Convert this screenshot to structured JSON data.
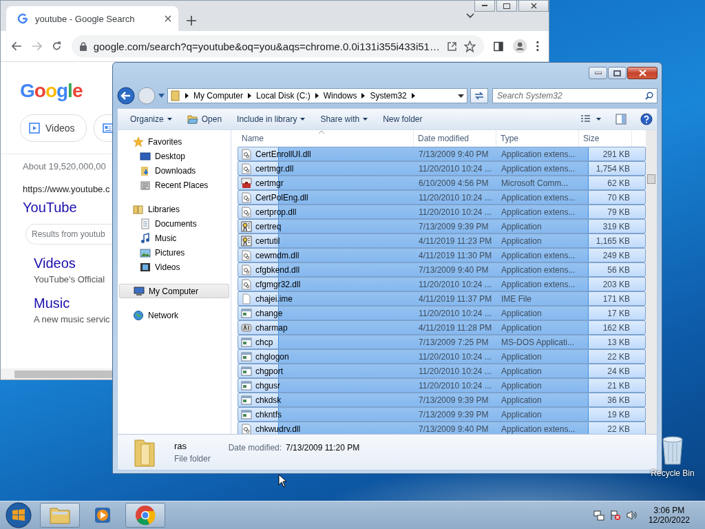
{
  "browser": {
    "tab": {
      "title": "youtube - Google Search",
      "selected": true
    },
    "address": "google.com/search?q=youtube&oq=you&aqs=chrome.0.0i131i355i433i51…",
    "page": {
      "logo": "Google",
      "chips": [
        {
          "label": "Videos",
          "kind": "videos"
        },
        {
          "kind": "news"
        }
      ],
      "stats": "About 19,520,000,00",
      "result_url": "https://www.youtube.c",
      "result_title": "YouTube",
      "site_search_placeholder": "Results from youtub",
      "sitelinks": [
        {
          "title": "Videos",
          "snippet": "YouTube's Official"
        },
        {
          "title": "Music",
          "snippet": "A new music servic"
        }
      ]
    }
  },
  "explorer": {
    "breadcrumb": [
      "My Computer",
      "Local Disk (C:)",
      "Windows",
      "System32"
    ],
    "search": {
      "placeholder": "Search System32"
    },
    "toolbar": [
      {
        "label": "Organize",
        "menu": true,
        "kind": "text"
      },
      {
        "label": "Open",
        "menu": false,
        "kind": "open"
      },
      {
        "label": "Include in library",
        "menu": true,
        "kind": "text"
      },
      {
        "label": "Share with",
        "menu": true,
        "kind": "text"
      },
      {
        "label": "New folder",
        "menu": false,
        "kind": "text"
      }
    ],
    "nav": [
      {
        "label": "Favorites",
        "kind": "star",
        "selected": false,
        "children": [
          {
            "label": "Desktop",
            "kind": "desktop",
            "selected": false
          },
          {
            "label": "Downloads",
            "kind": "downloads",
            "selected": false
          },
          {
            "label": "Recent Places",
            "kind": "places",
            "selected": false
          }
        ]
      },
      {
        "label": "Libraries",
        "kind": "library",
        "selected": false,
        "children": [
          {
            "label": "Documents",
            "kind": "document",
            "selected": false
          },
          {
            "label": "Music",
            "kind": "music",
            "selected": false
          },
          {
            "label": "Pictures",
            "kind": "pictures",
            "selected": false
          },
          {
            "label": "Videos",
            "kind": "videos",
            "selected": false
          }
        ]
      },
      {
        "label": "My Computer",
        "kind": "computer",
        "selected": true
      },
      {
        "label": "Network",
        "kind": "network",
        "selected": false
      }
    ],
    "columns": [
      "Name",
      "Date modified",
      "Type",
      "Size"
    ],
    "rows": [
      {
        "name": "CertEnrollUI.dll",
        "date": "7/13/2009 9:40 PM",
        "type": "Application extens...",
        "size": "291 KB",
        "kind": "dll",
        "selected": true
      },
      {
        "name": "certmgr.dll",
        "date": "11/20/2010 10:24 ...",
        "type": "Application extens...",
        "size": "1,754 KB",
        "kind": "dll",
        "selected": true
      },
      {
        "name": "certmgr",
        "date": "6/10/2009 4:56 PM",
        "type": "Microsoft Comm...",
        "size": "62 KB",
        "kind": "console",
        "selected": true
      },
      {
        "name": "CertPolEng.dll",
        "date": "11/20/2010 10:24 ...",
        "type": "Application extens...",
        "size": "70 KB",
        "kind": "dll",
        "selected": true
      },
      {
        "name": "certprop.dll",
        "date": "11/20/2010 10:24 ...",
        "type": "Application extens...",
        "size": "79 KB",
        "kind": "dll",
        "selected": true
      },
      {
        "name": "certreq",
        "date": "7/13/2009 9:39 PM",
        "type": "Application",
        "size": "319 KB",
        "kind": "certificate",
        "selected": true
      },
      {
        "name": "certutil",
        "date": "4/11/2019 11:23 PM",
        "type": "Application",
        "size": "1,165 KB",
        "kind": "certificate",
        "selected": true
      },
      {
        "name": "cewmdm.dll",
        "date": "4/11/2019 11:30 PM",
        "type": "Application extens...",
        "size": "249 KB",
        "kind": "dll",
        "selected": true
      },
      {
        "name": "cfgbkend.dll",
        "date": "7/13/2009 9:40 PM",
        "type": "Application extens...",
        "size": "56 KB",
        "kind": "dll",
        "selected": true
      },
      {
        "name": "cfgmgr32.dll",
        "date": "11/20/2010 10:24 ...",
        "type": "Application extens...",
        "size": "203 KB",
        "kind": "dll",
        "selected": true
      },
      {
        "name": "chajei.ime",
        "date": "4/11/2019 11:37 PM",
        "type": "IME File",
        "size": "171 KB",
        "kind": "file",
        "selected": true
      },
      {
        "name": "change",
        "date": "11/20/2010 10:24 ...",
        "type": "Application",
        "size": "17 KB",
        "kind": "app",
        "selected": true
      },
      {
        "name": "charmap",
        "date": "4/11/2019 11:28 PM",
        "type": "Application",
        "size": "162 KB",
        "kind": "charmap",
        "selected": true
      },
      {
        "name": "chcp",
        "date": "7/13/2009 7:25 PM",
        "type": "MS-DOS Applicati...",
        "size": "13 KB",
        "kind": "app",
        "selected": true
      },
      {
        "name": "chglogon",
        "date": "11/20/2010 10:24 ...",
        "type": "Application",
        "size": "22 KB",
        "kind": "app",
        "selected": true
      },
      {
        "name": "chgport",
        "date": "11/20/2010 10:24 ...",
        "type": "Application",
        "size": "24 KB",
        "kind": "app",
        "selected": true
      },
      {
        "name": "chgusr",
        "date": "11/20/2010 10:24 ...",
        "type": "Application",
        "size": "21 KB",
        "kind": "app",
        "selected": true
      },
      {
        "name": "chkdsk",
        "date": "7/13/2009 9:39 PM",
        "type": "Application",
        "size": "36 KB",
        "kind": "app",
        "selected": true
      },
      {
        "name": "chkntfs",
        "date": "7/13/2009 9:39 PM",
        "type": "Application",
        "size": "19 KB",
        "kind": "app",
        "selected": true
      },
      {
        "name": "chkwudrv.dll",
        "date": "7/13/2009 9:40 PM",
        "type": "Application extens...",
        "size": "22 KB",
        "kind": "dll",
        "selected": true
      }
    ],
    "details": {
      "name": "ras",
      "type": "File folder",
      "date_label": "Date modified:",
      "date": "7/13/2009 11:20 PM"
    }
  },
  "desktop": {
    "recycle_bin": "Recycle Bin"
  },
  "taskbar": {
    "time": "3:06 PM",
    "date": "12/20/2022"
  }
}
